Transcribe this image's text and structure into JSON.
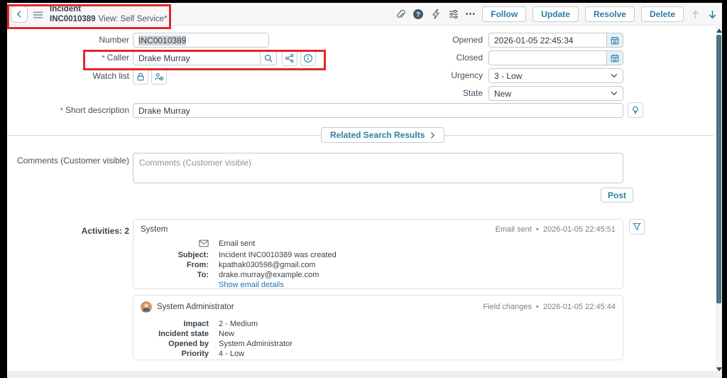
{
  "header": {
    "title": "Incident",
    "record_number": "INC0010389",
    "view_label": "View: Self Service*",
    "more_glyph": "•••",
    "actions": {
      "follow": "Follow",
      "update": "Update",
      "resolve": "Resolve",
      "delete": "Delete"
    }
  },
  "icons": {
    "back": "chevron-left",
    "menu": "hamburger",
    "attach": "paperclip",
    "help": "question-circle",
    "activity": "lightning-bolt",
    "personalize": "sliders",
    "more": "ellipsis",
    "search": "magnifier",
    "hierarchy": "org-chart",
    "info": "info-circle",
    "lock": "padlock",
    "add_person": "person-plus",
    "calendar": "calendar",
    "knowledge": "lightbulb",
    "filter": "funnel",
    "email": "envelope"
  },
  "form": {
    "mandatory_marker": "*",
    "number": {
      "label": "Number",
      "value": "INC0010389"
    },
    "caller": {
      "label": "Caller",
      "value": "Drake Murray"
    },
    "watch_list": {
      "label": "Watch list"
    },
    "short_description": {
      "label": "Short description",
      "value": "Drake Murray"
    },
    "opened": {
      "label": "Opened",
      "value": "2026-01-05 22:45:34"
    },
    "closed": {
      "label": "Closed",
      "value": ""
    },
    "urgency": {
      "label": "Urgency",
      "value": "3 - Low"
    },
    "state": {
      "label": "State",
      "value": "New"
    }
  },
  "related_search": {
    "label": "Related Search Results"
  },
  "comments": {
    "label": "Comments (Customer visible)",
    "placeholder": "Comments (Customer visible)",
    "post_label": "Post"
  },
  "activities": {
    "label": "Activities: 2",
    "entries": [
      {
        "author": "System",
        "type": "Email sent",
        "timestamp": "2026-01-05 22:45:51",
        "email": {
          "status": "Email sent",
          "subject_label": "Subject:",
          "subject": "Incident INC0010389 was created",
          "from_label": "From:",
          "from": "kpathak030598@gmail.com",
          "to_label": "To:",
          "to": "drake.murray@example.com",
          "link": "Show email details"
        }
      },
      {
        "author": "System Administrator",
        "type": "Field changes",
        "timestamp": "2026-01-05 22:45:44",
        "fields": [
          {
            "label": "Impact",
            "value": "2 - Medium"
          },
          {
            "label": "Incident state",
            "value": "New"
          },
          {
            "label": "Opened by",
            "value": "System Administrator"
          },
          {
            "label": "Priority",
            "value": "4 - Low"
          }
        ]
      }
    ]
  }
}
